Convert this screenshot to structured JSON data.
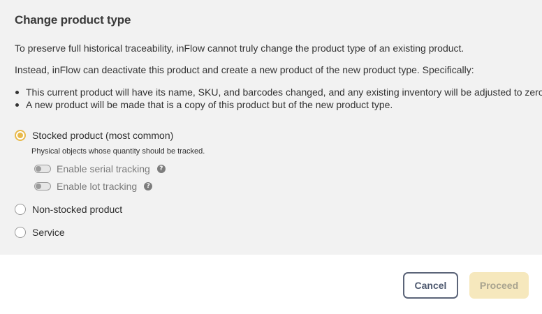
{
  "dialog": {
    "title": "Change product type",
    "intro": "To preserve full historical traceability, inFlow cannot truly change the product type of an existing product.",
    "instead": "Instead, inFlow can deactivate this product and create a new product of the new product type. Specifically:",
    "bullets": [
      "This current product will have its name, SKU, and barcodes changed, and any existing inventory will be adjusted to zero.",
      "A new product will be made that is a copy of this product but of the new product type."
    ]
  },
  "options": {
    "stocked": {
      "label": "Stocked product (most common)",
      "description": "Physical objects whose quantity should be tracked.",
      "selected": true
    },
    "serial_tracking": {
      "label": "Enable serial tracking",
      "enabled": false
    },
    "lot_tracking": {
      "label": "Enable lot tracking",
      "enabled": false
    },
    "non_stocked": {
      "label": "Non-stocked product",
      "selected": false
    },
    "service": {
      "label": "Service",
      "selected": false
    }
  },
  "help_glyph": "?",
  "icons": {
    "help": "help-icon"
  },
  "colors": {
    "accent": "#e8b94a",
    "panel_bg": "#f2f2f2",
    "cancel_border": "#5b6478",
    "proceed_bg_disabled": "#f6e8bd"
  },
  "footer": {
    "cancel_label": "Cancel",
    "proceed_label": "Proceed"
  }
}
